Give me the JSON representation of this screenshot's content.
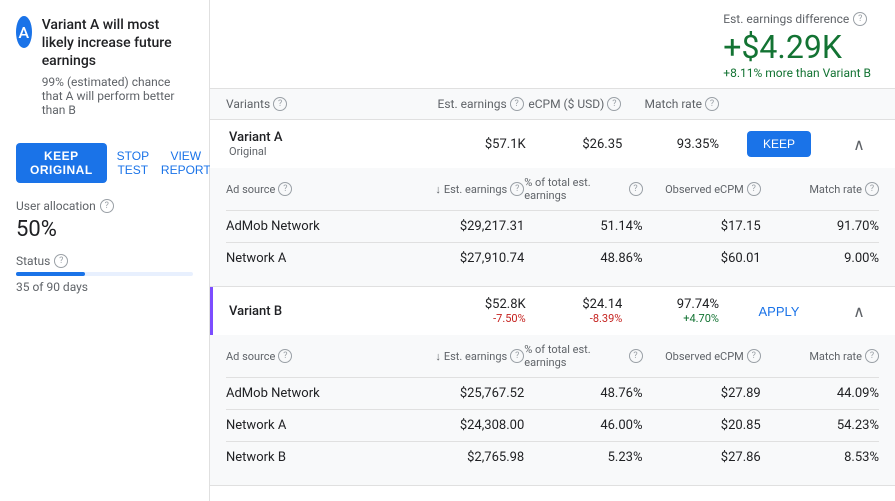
{
  "sidebar": {
    "avatar_letter": "A",
    "title": "Variant A will most likely increase future earnings",
    "subtitle": "99% (estimated) chance that A will perform better than B",
    "buttons": {
      "keep": "KEEP ORIGINAL",
      "stop": "STOP TEST",
      "view": "VIEW REPORT"
    },
    "user_allocation_label": "User allocation",
    "user_allocation_value": "50%",
    "status_label": "Status",
    "status_days": "35 of 90 days",
    "progress_percent": 39
  },
  "earnings_summary": {
    "label": "Est. earnings difference",
    "amount": "+$4.29K",
    "diff": "+8.11% more than Variant B"
  },
  "table": {
    "headers": {
      "variants": "Variants",
      "est_earnings": "Est. earnings",
      "ecpm": "eCPM ($ USD)",
      "match_rate": "Match rate"
    },
    "variant_a": {
      "name": "Variant A",
      "tag": "Original",
      "est_earnings": "$57.1K",
      "ecpm": "$26.35",
      "match_rate": "93.35%",
      "action": "KEEP",
      "sub_table": {
        "headers": {
          "ad_source": "Ad source",
          "est_earnings": "Est. earnings",
          "pct_earnings": "% of total est. earnings",
          "observed_ecpm": "Observed eCPM",
          "match_rate": "Match rate"
        },
        "rows": [
          {
            "ad_source": "AdMob Network",
            "est_earnings": "$29,217.31",
            "pct_earnings": "51.14%",
            "observed_ecpm": "$17.15",
            "match_rate": "91.70%"
          },
          {
            "ad_source": "Network A",
            "est_earnings": "$27,910.74",
            "pct_earnings": "48.86%",
            "observed_ecpm": "$60.01",
            "match_rate": "9.00%"
          }
        ]
      }
    },
    "variant_b": {
      "name": "Variant B",
      "est_earnings": "$52.8K",
      "est_earnings_diff": "-7.50%",
      "ecpm": "$24.14",
      "ecpm_diff": "-8.39%",
      "match_rate": "97.74%",
      "match_rate_diff": "+4.70%",
      "action": "APPLY",
      "sub_table": {
        "rows": [
          {
            "ad_source": "AdMob Network",
            "est_earnings": "$25,767.52",
            "pct_earnings": "48.76%",
            "observed_ecpm": "$27.89",
            "match_rate": "44.09%"
          },
          {
            "ad_source": "Network A",
            "est_earnings": "$24,308.00",
            "pct_earnings": "46.00%",
            "observed_ecpm": "$20.85",
            "match_rate": "54.23%"
          },
          {
            "ad_source": "Network B",
            "est_earnings": "$2,765.98",
            "pct_earnings": "5.23%",
            "observed_ecpm": "$27.86",
            "match_rate": "8.53%"
          }
        ]
      }
    }
  }
}
